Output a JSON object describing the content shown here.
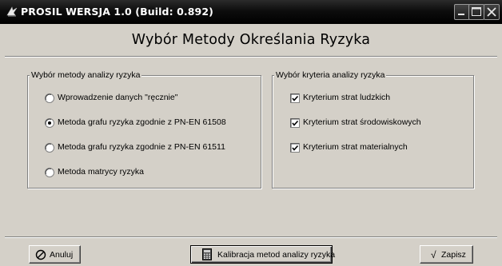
{
  "window": {
    "title": "PROSIL WERSJA 1.0 (Build: 0.892)",
    "buttons": [
      "minimize",
      "maximize",
      "close"
    ]
  },
  "header": {
    "title": "Wybór Metody Określania Ryzyka"
  },
  "method_group": {
    "legend": "Wybór metody analizy ryzyka",
    "options": [
      {
        "label": "Wprowadzenie danych \"ręcznie\"",
        "selected": false
      },
      {
        "label": "Metoda grafu ryzyka zgodnie z PN-EN 61508",
        "selected": true
      },
      {
        "label": "Metoda grafu ryzyka zgodnie z PN-EN 61511",
        "selected": false
      },
      {
        "label": "Metoda matrycy ryzyka",
        "selected": false
      }
    ]
  },
  "criteria_group": {
    "legend": "Wybór kryteria analizy ryzyka",
    "options": [
      {
        "label": "Kryterium strat ludzkich",
        "checked": true
      },
      {
        "label": "Kryterium strat środowiskowych",
        "checked": true
      },
      {
        "label": "Kryterium strat materialnych",
        "checked": true
      }
    ]
  },
  "footer": {
    "cancel_label": "Anuluj",
    "calibration_label": "Kalibracja metod analizy ryzyka",
    "save_label_prefix": "√",
    "save_label": "Zapisz"
  },
  "icons": {
    "cancel": "no-entry-icon",
    "calibration": "calculator-icon",
    "save": "checkmark-icon",
    "app": "prosil-app-icon"
  }
}
